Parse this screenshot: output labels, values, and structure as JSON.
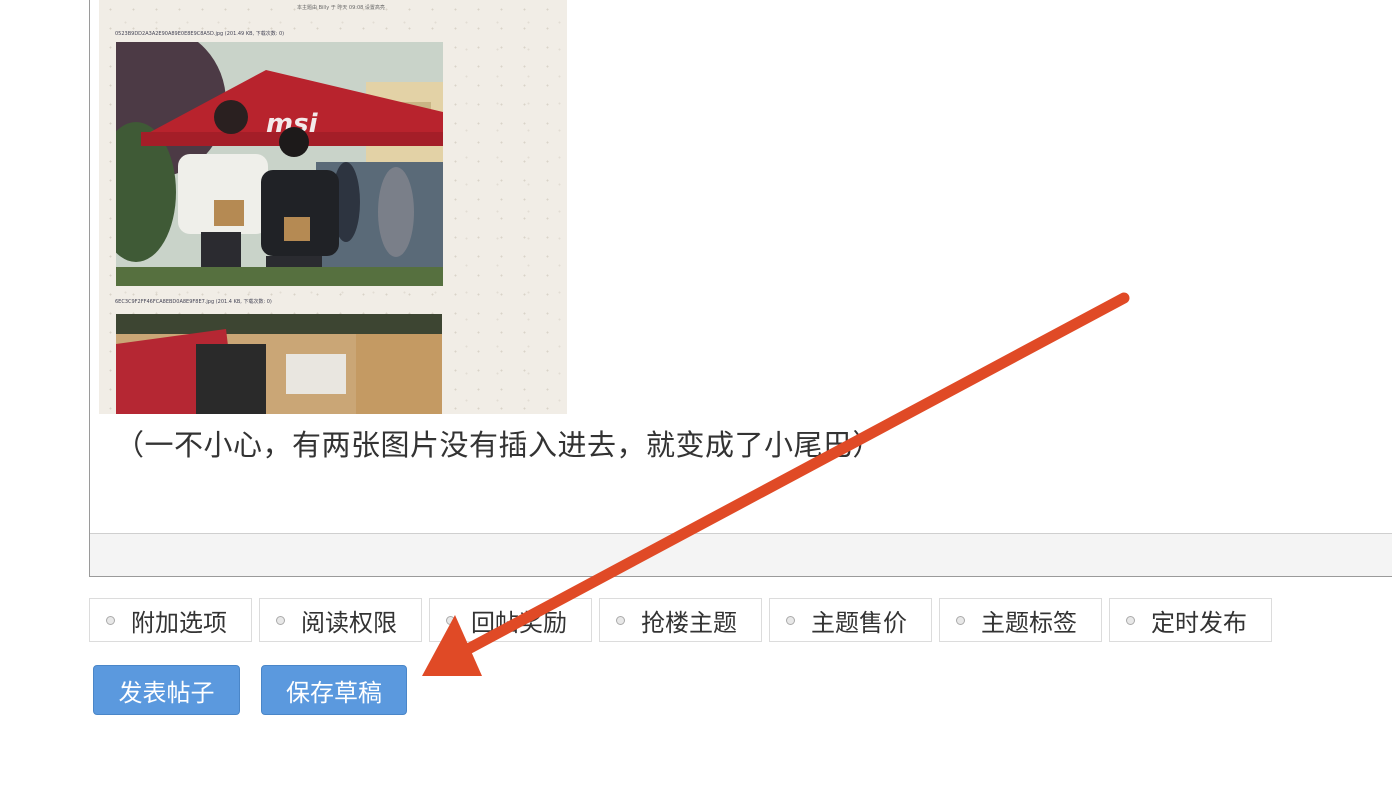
{
  "editor": {
    "embedded_post": {
      "caption_top": "本主题由 Billy 于 昨天 09:08 设置高亮",
      "attachment_1": "0523B9DD2A3A2E90A89E0E8E9C8A5D.jpg",
      "attachment_1_meta": "(201.49 KB, 下载次数: 0)",
      "attachment_2": "6EC3C9F2FF46FCA8EBD0A8E9F8E7.jpg",
      "attachment_2_meta": "(201.4 KB, 下载次数: 0)",
      "photo_1_icon": "photo-msi-tent-two-students",
      "photo_2_icon": "photo-box-with-items"
    },
    "body_text": "（一不小心，有两张图片没有插入进去，就变成了小尾巴）"
  },
  "options": [
    {
      "label": "附加选项"
    },
    {
      "label": "阅读权限"
    },
    {
      "label": "回帖奖励"
    },
    {
      "label": "抢楼主题"
    },
    {
      "label": "主题售价"
    },
    {
      "label": "主题标签"
    },
    {
      "label": "定时发布"
    }
  ],
  "buttons": {
    "publish": "发表帖子",
    "save_draft": "保存草稿"
  },
  "colors": {
    "button_blue": "#5b99de",
    "annotation_arrow": "#e04a26"
  }
}
